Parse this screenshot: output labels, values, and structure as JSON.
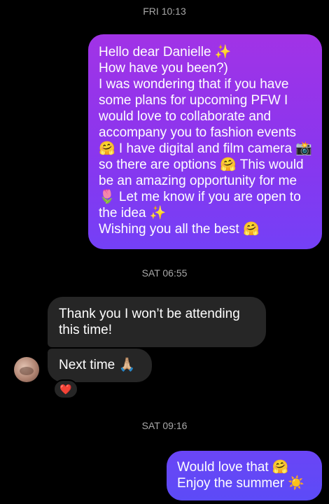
{
  "conversation": {
    "timestamps": {
      "first": "FRI 10:13",
      "second": "SAT 06:55",
      "third": "SAT 09:16"
    },
    "messages": {
      "sent_long": "Hello dear Danielle ✨\nHow have you been?)\nI was wondering that if you have some plans for upcoming PFW I would love to collaborate and accompany you to fashion events 🤗 I have digital and film camera 📸 so there are options 🤗 This would be an amazing opportunity for me 🌷 Let me know if you are open to the idea ✨\nWishing you all the best 🤗",
      "received_first": "Thank you I won’t be attending this time!",
      "received_second": "Next time 🙏🏼",
      "sent_short": "Would love that 🤗\nEnjoy the summer ☀️"
    },
    "reaction": "❤️"
  },
  "colors": {
    "background": "#000000",
    "received_bubble": "#262626",
    "sent_gradient_top": "#a133e6",
    "sent_gradient_bottom": "#7440f6",
    "timestamp_text": "#a8a8a8",
    "reaction_heart": "#e0245e"
  }
}
